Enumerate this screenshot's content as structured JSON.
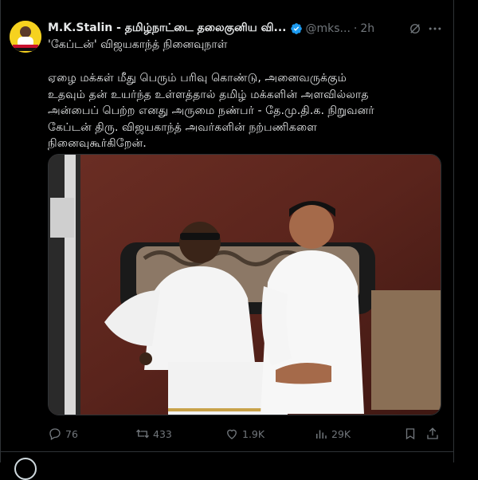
{
  "tweet": {
    "author_name": "M.K.Stalin - தமிழ்நாட்டை தலைகுனிய வி...",
    "handle": "@mks...",
    "time": "2h",
    "subtitle": "'கேப்டன்' விஜயகாந்த் நினைவுநாள்",
    "body": "ஏழை மக்கள் மீது பெரும் பரிவு கொண்டு, அனைவருக்கும்\nஉதவும் தன் உயர்ந்த உள்ளத்தால் தமிழ் மக்களின் அளவில்லாத\nஅன்பைப் பெற்ற எனது அருமை நண்பர் - தே.மு.தி.க. நிறுவனர்\nகேப்டன் திரு. விஜயகாந்த் அவர்களின் நற்பணிகளை\nநினைவுகூர்கிறேன்."
  },
  "actions": {
    "replies": "76",
    "reposts": "433",
    "likes": "1.9K",
    "views": "29K"
  },
  "icons": {
    "avatar": "profile-avatar",
    "verified": "verified-badge-icon",
    "grok": "grok-icon",
    "more": "more-icon",
    "reply": "reply-icon",
    "repost": "repost-icon",
    "like": "heart-icon",
    "views": "views-icon",
    "bookmark": "bookmark-icon",
    "share": "share-icon"
  },
  "colors": {
    "background": "#000000",
    "text": "#e7e9ea",
    "muted": "#71767b",
    "verified": "#1d9bf0",
    "divider": "#2f3336"
  }
}
